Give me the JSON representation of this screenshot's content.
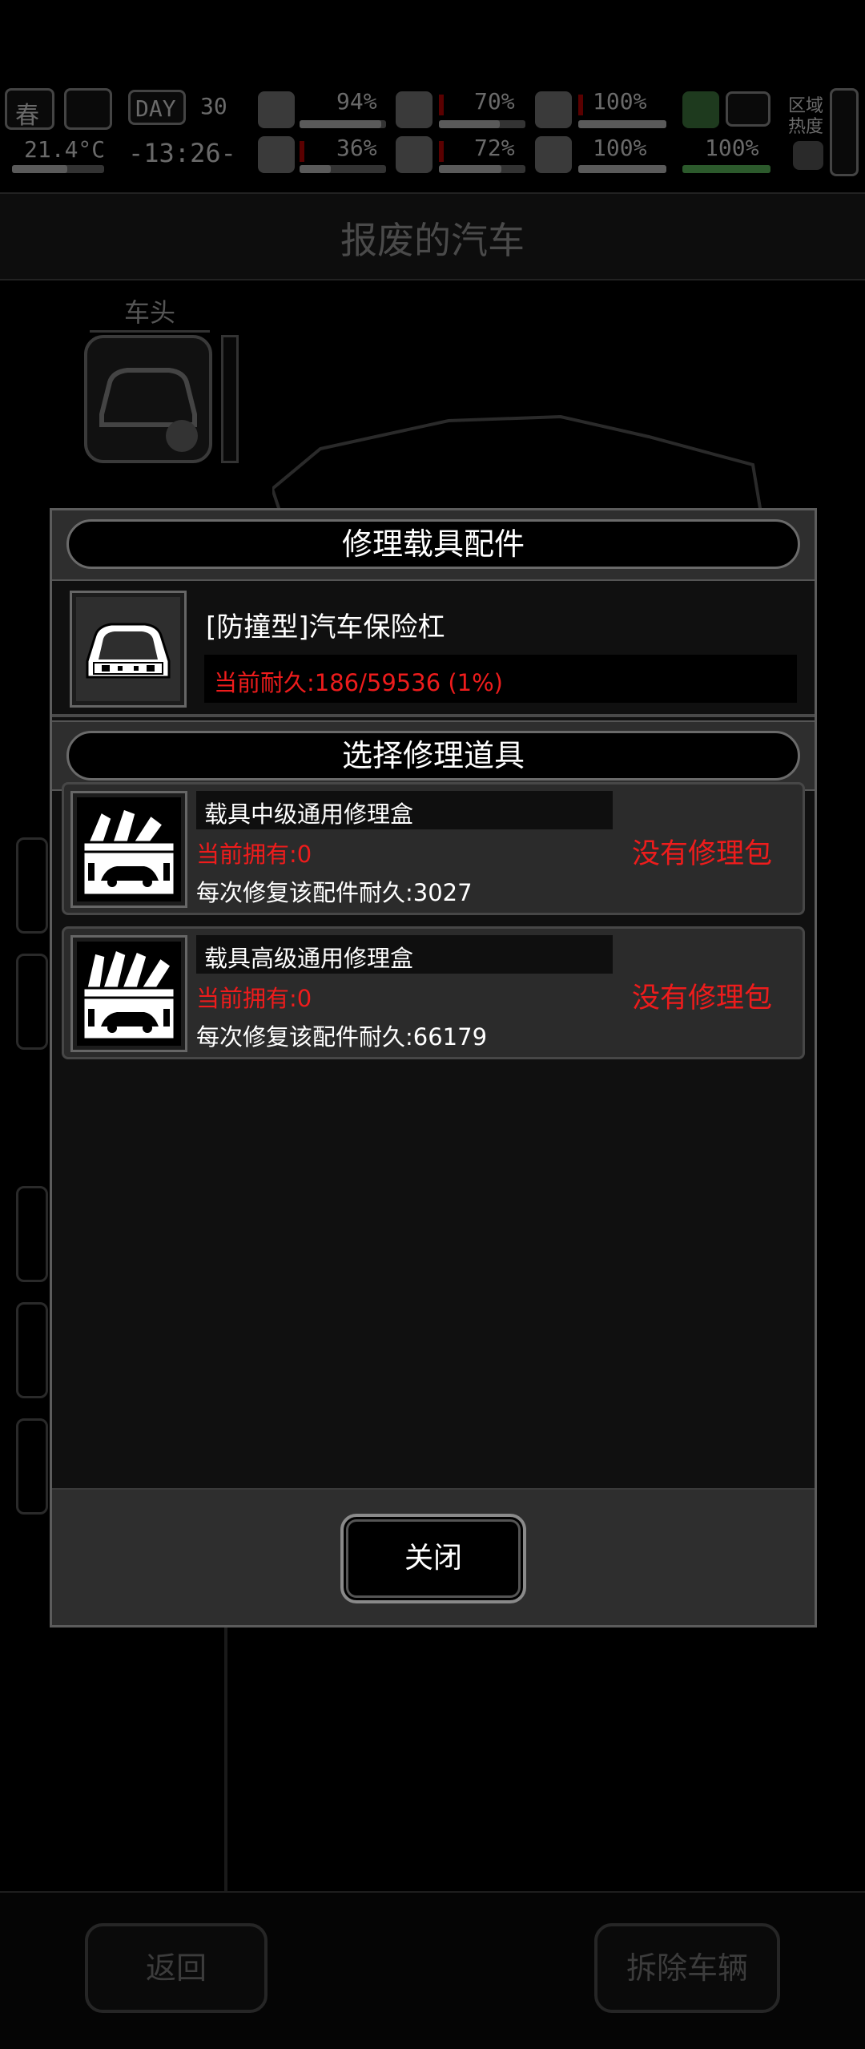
{
  "background": {
    "hud": {
      "season": "春",
      "temperature": "21.4°C",
      "day_badge": "DAY",
      "day_number": "30",
      "clock": "-13:26-",
      "health_pct": "94%",
      "stomach_pct": "70%",
      "bladder_pct": "100%",
      "sanity_pct": "36%",
      "water_pct": "72%",
      "heart_pct": "100%",
      "stamina_pct": "100%",
      "region_heat_label": "区域热度"
    },
    "page_title": "报废的汽车",
    "part_tab": "车头",
    "back_button": "返回",
    "dismantle_button": "拆除车辆"
  },
  "modal": {
    "title": "修理载具配件",
    "part": {
      "name": "[防撞型]汽车保险杠",
      "durability": "当前耐久:186/59536 (1%)",
      "icon": "car-bumper-icon"
    },
    "tools_title": "选择修理道具",
    "tools": [
      {
        "name": "载具中级通用修理盒",
        "owned": "当前拥有:0",
        "effect": "每次修复该配件耐久:3027",
        "status": "没有修理包",
        "icon": "repair-toolbox-icon"
      },
      {
        "name": "载具高级通用修理盒",
        "owned": "当前拥有:0",
        "effect": "每次修复该配件耐久:66179",
        "status": "没有修理包",
        "icon": "repair-toolbox-advanced-icon"
      }
    ],
    "close_label": "关闭"
  },
  "colors": {
    "warning_red": "#ee1c1c",
    "panel_gray": "#2e2e2e",
    "dim_overlay": "#000000"
  }
}
